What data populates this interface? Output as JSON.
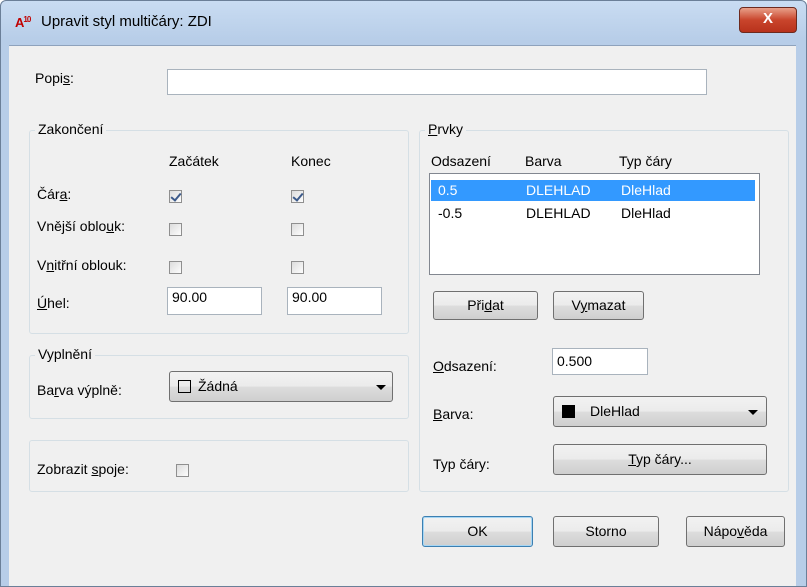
{
  "window": {
    "title": "Upravit styl multičáry: ZDI",
    "icon_text": "A",
    "icon_sub": "10",
    "close_symbol": "X"
  },
  "description": {
    "label_pre": "Popi",
    "label_u": "s",
    "label_post": ":",
    "value": ""
  },
  "caps": {
    "title": "Zakončení",
    "col_start": "Začátek",
    "col_end": "Konec",
    "rows": [
      {
        "pre": "Čár",
        "u": "a",
        "post": ":",
        "start_checked": true,
        "end_checked": true
      },
      {
        "pre": "Vnější oblo",
        "u": "u",
        "post": "k:",
        "start_checked": false,
        "end_checked": false
      },
      {
        "pre": "V",
        "u": "n",
        "post": "itřní oblouk:",
        "start_checked": false,
        "end_checked": false
      }
    ],
    "angle": {
      "pre": "",
      "u": "Ú",
      "post": "hel:",
      "start": "90.00",
      "end": "90.00"
    }
  },
  "fill": {
    "title": "Vyplnění",
    "label_pre": "Ba",
    "label_u": "r",
    "label_post": "va výplně:",
    "value": "Žádná",
    "swatch_color": "#ffffff"
  },
  "joints": {
    "label_pre": "Zobrazit ",
    "label_u": "s",
    "label_post": "poje:",
    "checked": false
  },
  "elements": {
    "title": "Prvky",
    "title_u": "P",
    "title_rest": "rvky",
    "headers": [
      "Odsazení",
      "Barva",
      "Typ čáry"
    ],
    "rows": [
      {
        "offset": "0.5",
        "color": "DLEHLAD",
        "linetype": "DleHlad",
        "selected": true
      },
      {
        "offset": "-0.5",
        "color": "DLEHLAD",
        "linetype": "DleHlad",
        "selected": false
      }
    ],
    "add_pre": "Při",
    "add_u": "d",
    "add_post": "at",
    "remove_pre": "V",
    "remove_u": "y",
    "remove_post": "mazat",
    "offset_label_pre": "",
    "offset_label_u": "O",
    "offset_label_post": "dsazení:",
    "offset_value": "0.500",
    "color_label_pre": "",
    "color_label_u": "B",
    "color_label_post": "arva:",
    "color_value": "DleHlad",
    "color_swatch": "#000000",
    "linetype_label": "Typ čáry:",
    "linetype_btn_pre": "",
    "linetype_btn_u": "T",
    "linetype_btn_post": "yp čáry..."
  },
  "footer": {
    "ok": "OK",
    "cancel": "Storno",
    "help_pre": "Nápo",
    "help_u": "v",
    "help_post": "ěda"
  }
}
